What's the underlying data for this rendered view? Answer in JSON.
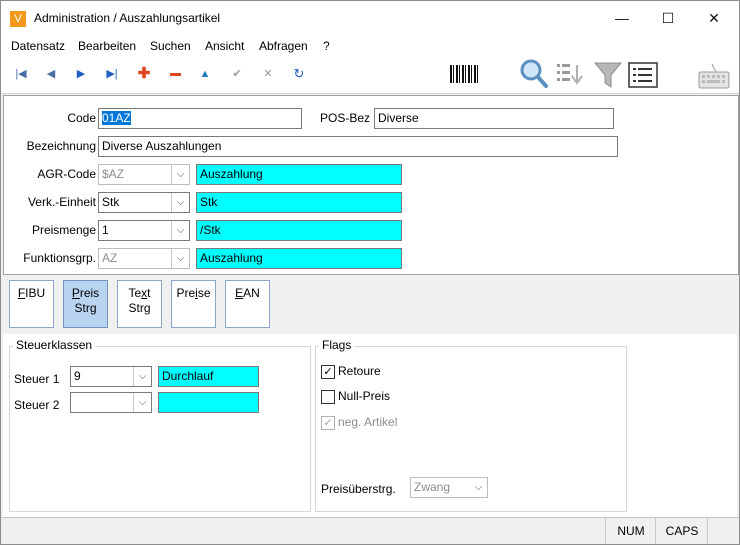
{
  "window": {
    "title": "Administration / Auszahlungsartikel",
    "app_icon_letter": "V",
    "minimize": "—",
    "maximize": "☐",
    "close": "✕"
  },
  "menu": [
    "Datensatz",
    "Bearbeiten",
    "Suchen",
    "Ansicht",
    "Abfragen",
    "?"
  ],
  "toolbar_icons": [
    "first-record",
    "previous-record",
    "next-record",
    "last-record",
    "add-record",
    "delete-record",
    "edit-record",
    "save-record",
    "cancel-record",
    "refresh",
    "barcode",
    "search",
    "sort",
    "filter",
    "list-view",
    "keyboard"
  ],
  "form": {
    "code_label": "Code",
    "code_value": "01AZ",
    "posbez_label": "POS-Bez",
    "posbez_value": "Diverse",
    "bezeichnung_label": "Bezeichnung",
    "bezeichnung_value": "Diverse Auszahlungen",
    "agr_label": "AGR-Code",
    "agr_value": "$AZ",
    "agr_desc": "Auszahlung",
    "verk_label": "Verk.-Einheit",
    "verk_value": "Stk",
    "verk_desc": "Stk",
    "preismenge_label": "Preismenge",
    "preismenge_value": "1",
    "preismenge_desc": "/Stk",
    "funktion_label": "Funktionsgrp.",
    "funktion_value": "AZ",
    "funktion_desc": "Auszahlung"
  },
  "tabs": [
    {
      "key": "F",
      "rest": "IBU",
      "line2": ""
    },
    {
      "key": "P",
      "rest": "reis",
      "line2": "Strg"
    },
    {
      "pre": "Te",
      "key": "x",
      "rest": "t",
      "line2": "Strg"
    },
    {
      "pre": "Pre",
      "key": "i",
      "rest": "se",
      "line2": ""
    },
    {
      "key": "E",
      "rest": "AN",
      "line2": ""
    }
  ],
  "steuer": {
    "title": "Steuerklassen",
    "steuer1_label": "Steuer 1",
    "steuer1_value": "9",
    "steuer1_desc": "Durchlauf",
    "steuer2_label": "Steuer 2",
    "steuer2_value": "",
    "steuer2_desc": ""
  },
  "flags": {
    "title": "Flags",
    "retoure_label": "Retoure",
    "retoure_checked": true,
    "nullpreis_label": "Null-Preis",
    "nullpreis_checked": false,
    "negartikel_label": "neg. Artikel",
    "negartikel_checked": true,
    "preisueberstrg_label": "Preisüberstrg.",
    "preisueberstrg_value": "Zwang"
  },
  "status": {
    "num": "NUM",
    "caps": "CAPS"
  },
  "colors": {
    "desc_field": "#00ffff",
    "active_tab": "#b9d4f1",
    "selection": "#0078d7",
    "app_icon": "#f39a1e"
  }
}
